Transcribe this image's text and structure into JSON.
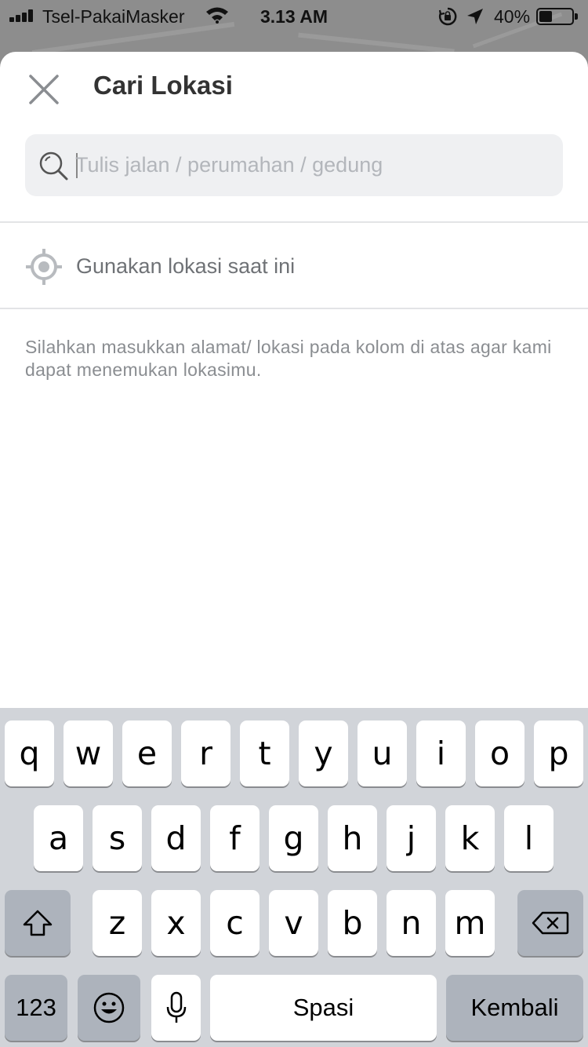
{
  "status_bar": {
    "carrier": "Tsel-PakaiMasker",
    "time": "3.13 AM",
    "battery_percent": "40%",
    "battery_level": 0.4
  },
  "sheet": {
    "title": "Cari Lokasi",
    "search": {
      "placeholder": "Tulis jalan / perumahan / gedung",
      "value": ""
    },
    "current_location_label": "Gunakan lokasi saat ini",
    "hint": "Silahkan masukkan alamat/ lokasi pada kolom di atas agar kami dapat menemukan lokasimu."
  },
  "keyboard": {
    "row1": [
      "q",
      "w",
      "e",
      "r",
      "t",
      "y",
      "u",
      "i",
      "o",
      "p"
    ],
    "row2": [
      "a",
      "s",
      "d",
      "f",
      "g",
      "h",
      "j",
      "k",
      "l"
    ],
    "row3": [
      "z",
      "x",
      "c",
      "v",
      "b",
      "n",
      "m"
    ],
    "numbers_label": "123",
    "space_label": "Spasi",
    "return_label": "Kembali"
  },
  "colors": {
    "sheet_background": "#ffffff",
    "search_background": "#eff0f2",
    "keyboard_background": "#d1d4d9",
    "key_background": "#ffffff",
    "function_key_background": "#adb3bc"
  }
}
